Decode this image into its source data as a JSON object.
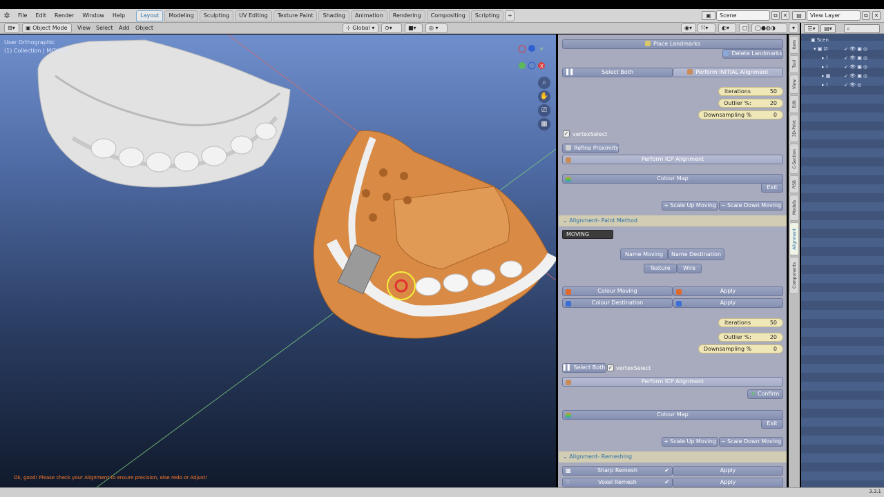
{
  "topbar": {
    "menus": [
      "File",
      "Edit",
      "Render",
      "Window",
      "Help"
    ],
    "workspaces": [
      "Layout",
      "Modeling",
      "Sculpting",
      "UV Editing",
      "Texture Paint",
      "Shading",
      "Animation",
      "Rendering",
      "Compositing",
      "Scripting"
    ],
    "active_workspace": "Layout",
    "scene": "Scene",
    "view_layer": "View Layer"
  },
  "viewport_header": {
    "mode": "Object Mode",
    "menus": [
      "View",
      "Select",
      "Add",
      "Object"
    ],
    "orientation": "Global"
  },
  "viewport": {
    "view_name": "User Orthographic",
    "collection": "(1) Collection | MOVING",
    "status_message": "Ok, good! Please check your Alignment to ensure precision, else redo or Adjust!",
    "gizmo_axes": [
      "Y",
      "X"
    ]
  },
  "panel": {
    "place_landmarks": "Place Landmarks",
    "delete_landmarks": "Delete Landmarks",
    "select_both": "Select Both",
    "perform_initial": "Perform INITIAL Alignment",
    "fields1": [
      {
        "label": "iterations",
        "value": "50"
      },
      {
        "label": "Outlier %:",
        "value": "20"
      },
      {
        "label": "Downsampling %",
        "value": "0"
      }
    ],
    "vertex_select": "vertexSelect",
    "refine_proximity": "Refine Proximity",
    "perform_icp": "Perform ICP Alignment",
    "colour_map": "Colour Map",
    "exit": "Exit",
    "scale_up": "Scale Up  Moving",
    "scale_down": "Scale Down Moving",
    "section_paint": "Alignment- Paint Method",
    "moving_value": "MOVING",
    "name_moving": "Name Moving",
    "name_destination": "Name Destination",
    "texture": "Texture",
    "wire": "Wire",
    "colour_moving": "Colour Moving",
    "colour_destination": "Colour Destination",
    "apply": "Apply",
    "fields2": [
      {
        "label": "iterations",
        "value": "50"
      },
      {
        "label": "Outlier %:",
        "value": "20"
      },
      {
        "label": "Downsampling %",
        "value": "0"
      }
    ],
    "confirm": "Confirm",
    "section_remesh": "Alignment- Remeshing",
    "sharp_remesh": "Sharp Remesh",
    "voxel_remesh": "Voxel Remesh"
  },
  "side_tabs": [
    "Item",
    "Tool",
    "View",
    "Edit",
    "3D-Print",
    "C-Section",
    "RSB",
    "Models",
    "Alignment",
    "Components"
  ],
  "active_side_tab": "Alignment",
  "outliner": {
    "root": "Scen"
  },
  "version": "3.3.1",
  "colors": {
    "accent": "#2b6fa8",
    "model_orange": "#d98a45",
    "field_yellow": "#f0e7b8",
    "status_orange": "#ff7a2a"
  }
}
